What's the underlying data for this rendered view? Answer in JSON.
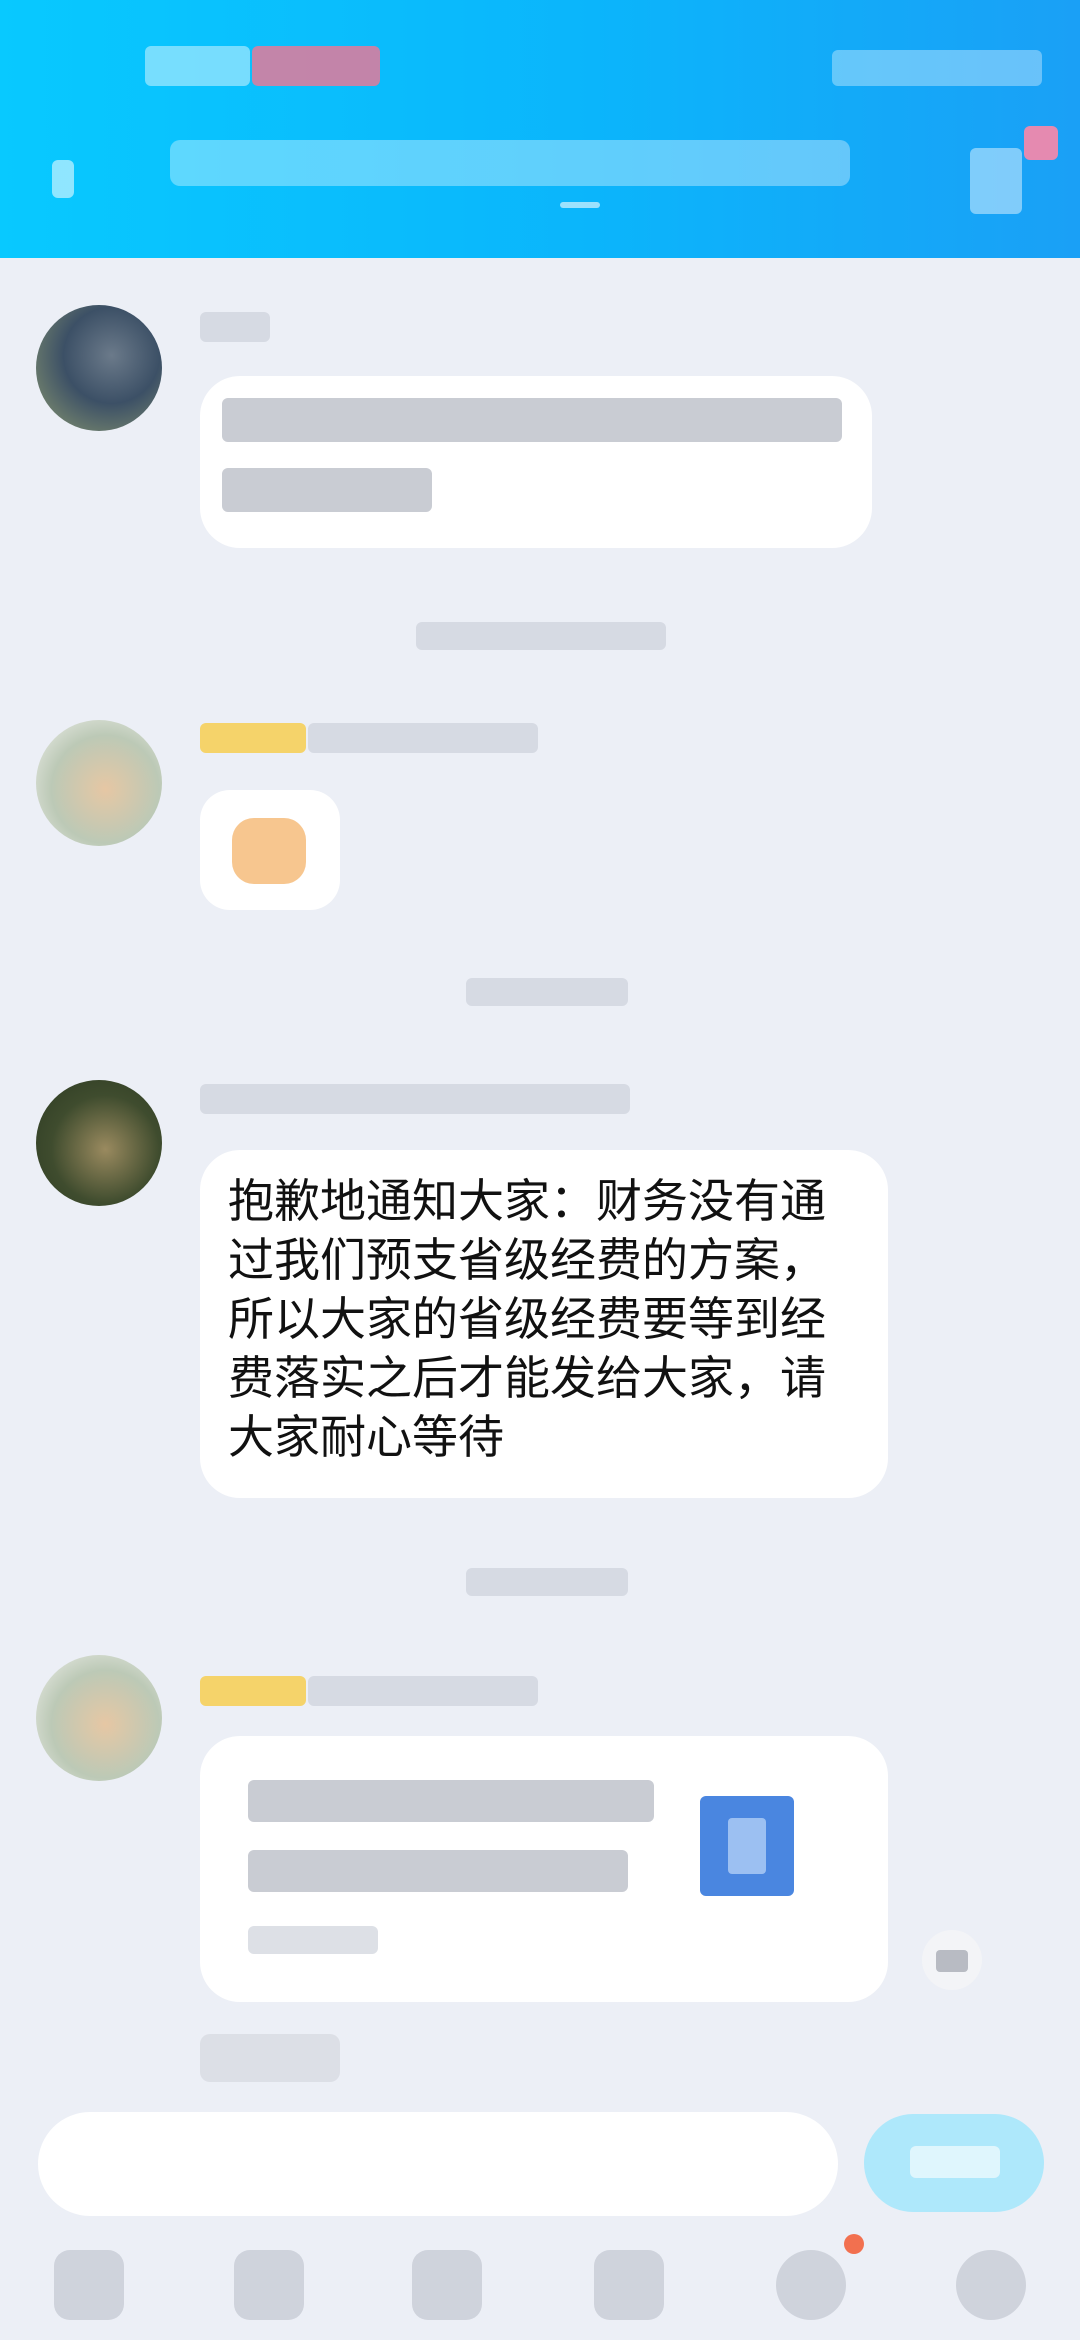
{
  "chat": {
    "messages": [
      {
        "type": "text",
        "text": "抱歉地通知大家：财务没有通过我们预支省级经费的方案，所以大家的省级经费要等到经费落实之后才能发给大家，请大家耐心等待"
      }
    ]
  },
  "colors": {
    "header_gradient_start": "#08c9ff",
    "header_gradient_end": "#1aa0f6",
    "background": "#eceff6",
    "bubble": "#ffffff",
    "send_button": "#aee8fb",
    "badge": "#f2704f",
    "member_tag": "#f5d36a"
  },
  "icons": {
    "back": "back-arrow-icon",
    "menu": "more-menu-icon",
    "toolbar": [
      "voice-icon",
      "image-icon",
      "camera-icon",
      "redpacket-icon",
      "emoji-icon",
      "plus-icon"
    ]
  }
}
